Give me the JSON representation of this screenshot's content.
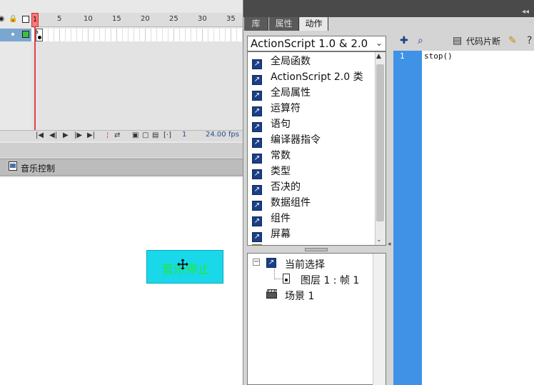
{
  "timeline": {
    "ruler_ticks": [
      "1",
      "5",
      "10",
      "15",
      "20",
      "25",
      "30",
      "35"
    ],
    "current_frame": "1",
    "fps": "24.00",
    "fps_unit": "fps"
  },
  "stage": {
    "scene_name": "音乐控制",
    "button_label": "音乐停止"
  },
  "panel": {
    "tabs": [
      "库",
      "属性",
      "动作"
    ],
    "active_tab": "动作"
  },
  "actions": {
    "version": "ActionScript 1.0 & 2.0",
    "toolbox_items": [
      "全局函数",
      "ActionScript 2.0 类",
      "全局属性",
      "运算符",
      "语句",
      "编译器指令",
      "常数",
      "类型",
      "否决的",
      "数据组件",
      "组件",
      "屏幕"
    ],
    "navigator": {
      "current_selection": "当前选择",
      "frame": "图层 1 : 帧 1",
      "scene": "场景 1"
    },
    "toolbar": {
      "snippets": "代码片断"
    },
    "editor": {
      "line_number": "1",
      "code": "stop()"
    }
  },
  "colors": {
    "button_fill": "#18d8ea",
    "button_text": "#22e838",
    "gutter": "#3f92e6",
    "layer_highlight": "#7aa6cf",
    "playhead": "#d44444"
  }
}
